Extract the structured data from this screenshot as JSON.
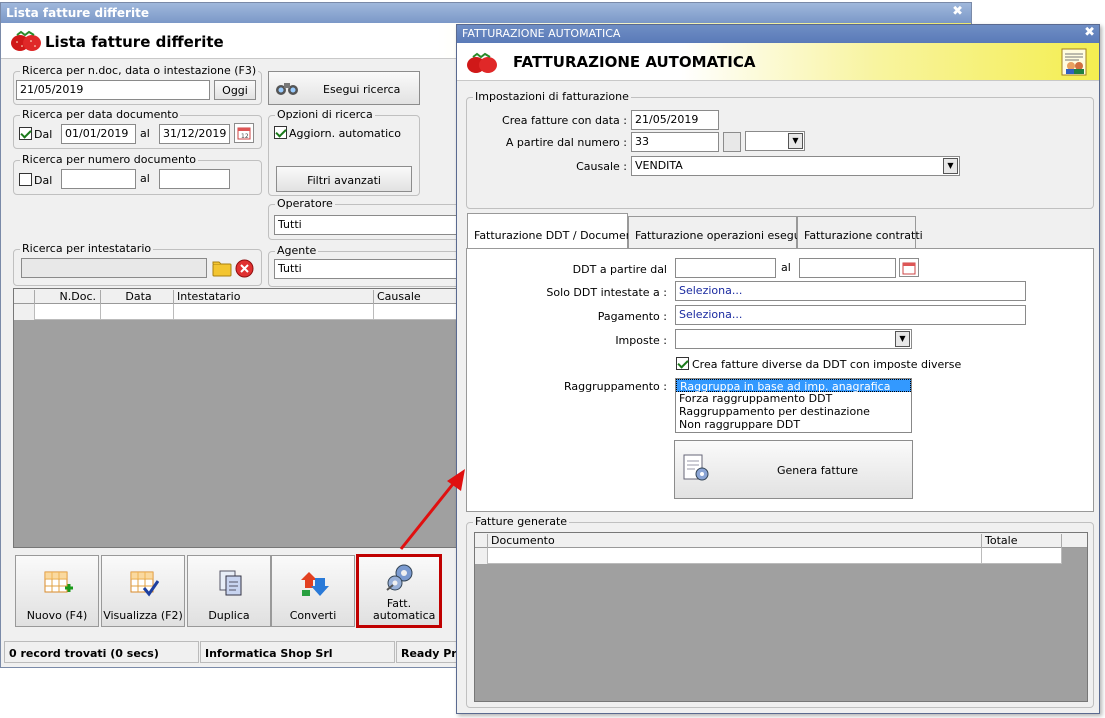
{
  "main_window": {
    "title": "Lista fatture differite",
    "header_title": "Lista fatture differite",
    "search_text": {
      "group_label": "Ricerca per n.doc, data o intestazione (F3)",
      "value": "21/05/2019",
      "today_button": "Oggi"
    },
    "search_button": "Esegui ricerca",
    "date_search": {
      "group_label": "Ricerca per data documento",
      "dal_label": "Dal",
      "from": "01/01/2019",
      "al_label": "al",
      "to": "31/12/2019"
    },
    "number_search": {
      "group_label": "Ricerca per numero documento",
      "dal_label": "Dal",
      "from": "",
      "al_label": "al",
      "to": ""
    },
    "search_options": {
      "group_label": "Opzioni di ricerca",
      "auto_update_label": "Aggiorn. automatico",
      "advanced_filters": "Filtri avanzati"
    },
    "operator": {
      "group_label": "Operatore",
      "value": "Tutti"
    },
    "holder_search": {
      "group_label": "Ricerca per intestatario",
      "value": ""
    },
    "agent": {
      "group_label": "Agente",
      "value": "Tutti"
    },
    "table": {
      "columns": [
        "N.Doc.",
        "Data",
        "Intestatario",
        "Causale"
      ]
    },
    "toolbar": [
      {
        "label": "Nuovo (F4)",
        "icon": "new-grid-icon"
      },
      {
        "label": "Visualizza (F2)",
        "icon": "view-grid-icon"
      },
      {
        "label": "Duplica",
        "icon": "duplicate-icon"
      },
      {
        "label": "Converti",
        "icon": "convert-icon"
      },
      {
        "label": "Fatt. automatica",
        "icon": "automatic-invoice-icon"
      }
    ],
    "status": {
      "records": "0 record trovati (0 secs)",
      "company": "Informatica Shop Srl",
      "ready": "Ready Pro"
    }
  },
  "dialog": {
    "title": "FATTURAZIONE AUTOMATICA",
    "header_title": "FATTURAZIONE AUTOMATICA",
    "settings": {
      "group_label": "Impostazioni di fatturazione",
      "create_date_label": "Crea fatture con data :",
      "create_date": "21/05/2019",
      "start_number_label": "A partire dal numero :",
      "start_number": "33",
      "causale_label": "Causale :",
      "causale": "VENDITA"
    },
    "tabs": [
      "Fatturazione DDT / Documenti",
      "Fatturazione operazioni eseguite",
      "Fatturazione contratti"
    ],
    "ddt": {
      "from_label": "DDT a partire dal",
      "al_label": "al",
      "from": "",
      "to": "",
      "only_ddt_label": "Solo DDT intestate a :",
      "only_ddt_value": "Seleziona...",
      "payment_label": "Pagamento :",
      "payment_value": "Seleziona...",
      "taxes_label": "Imposte :",
      "taxes_value": "",
      "diff_taxes_label": "Crea fatture diverse da DDT con imposte diverse",
      "grouping_label": "Raggruppamento :",
      "grouping_options": [
        "Raggruppa in base ad imp. anagrafica",
        "Forza raggruppamento DDT",
        "Raggruppamento per destinazione",
        "Non raggruppare DDT"
      ],
      "generate_button": "Genera fatture"
    },
    "generated": {
      "group_label": "Fatture generate",
      "columns": [
        "Documento",
        "Totale"
      ]
    }
  },
  "colors": {
    "arrow": "#e01010",
    "highlight_border": "#c00000",
    "selection": "#3399ff"
  }
}
